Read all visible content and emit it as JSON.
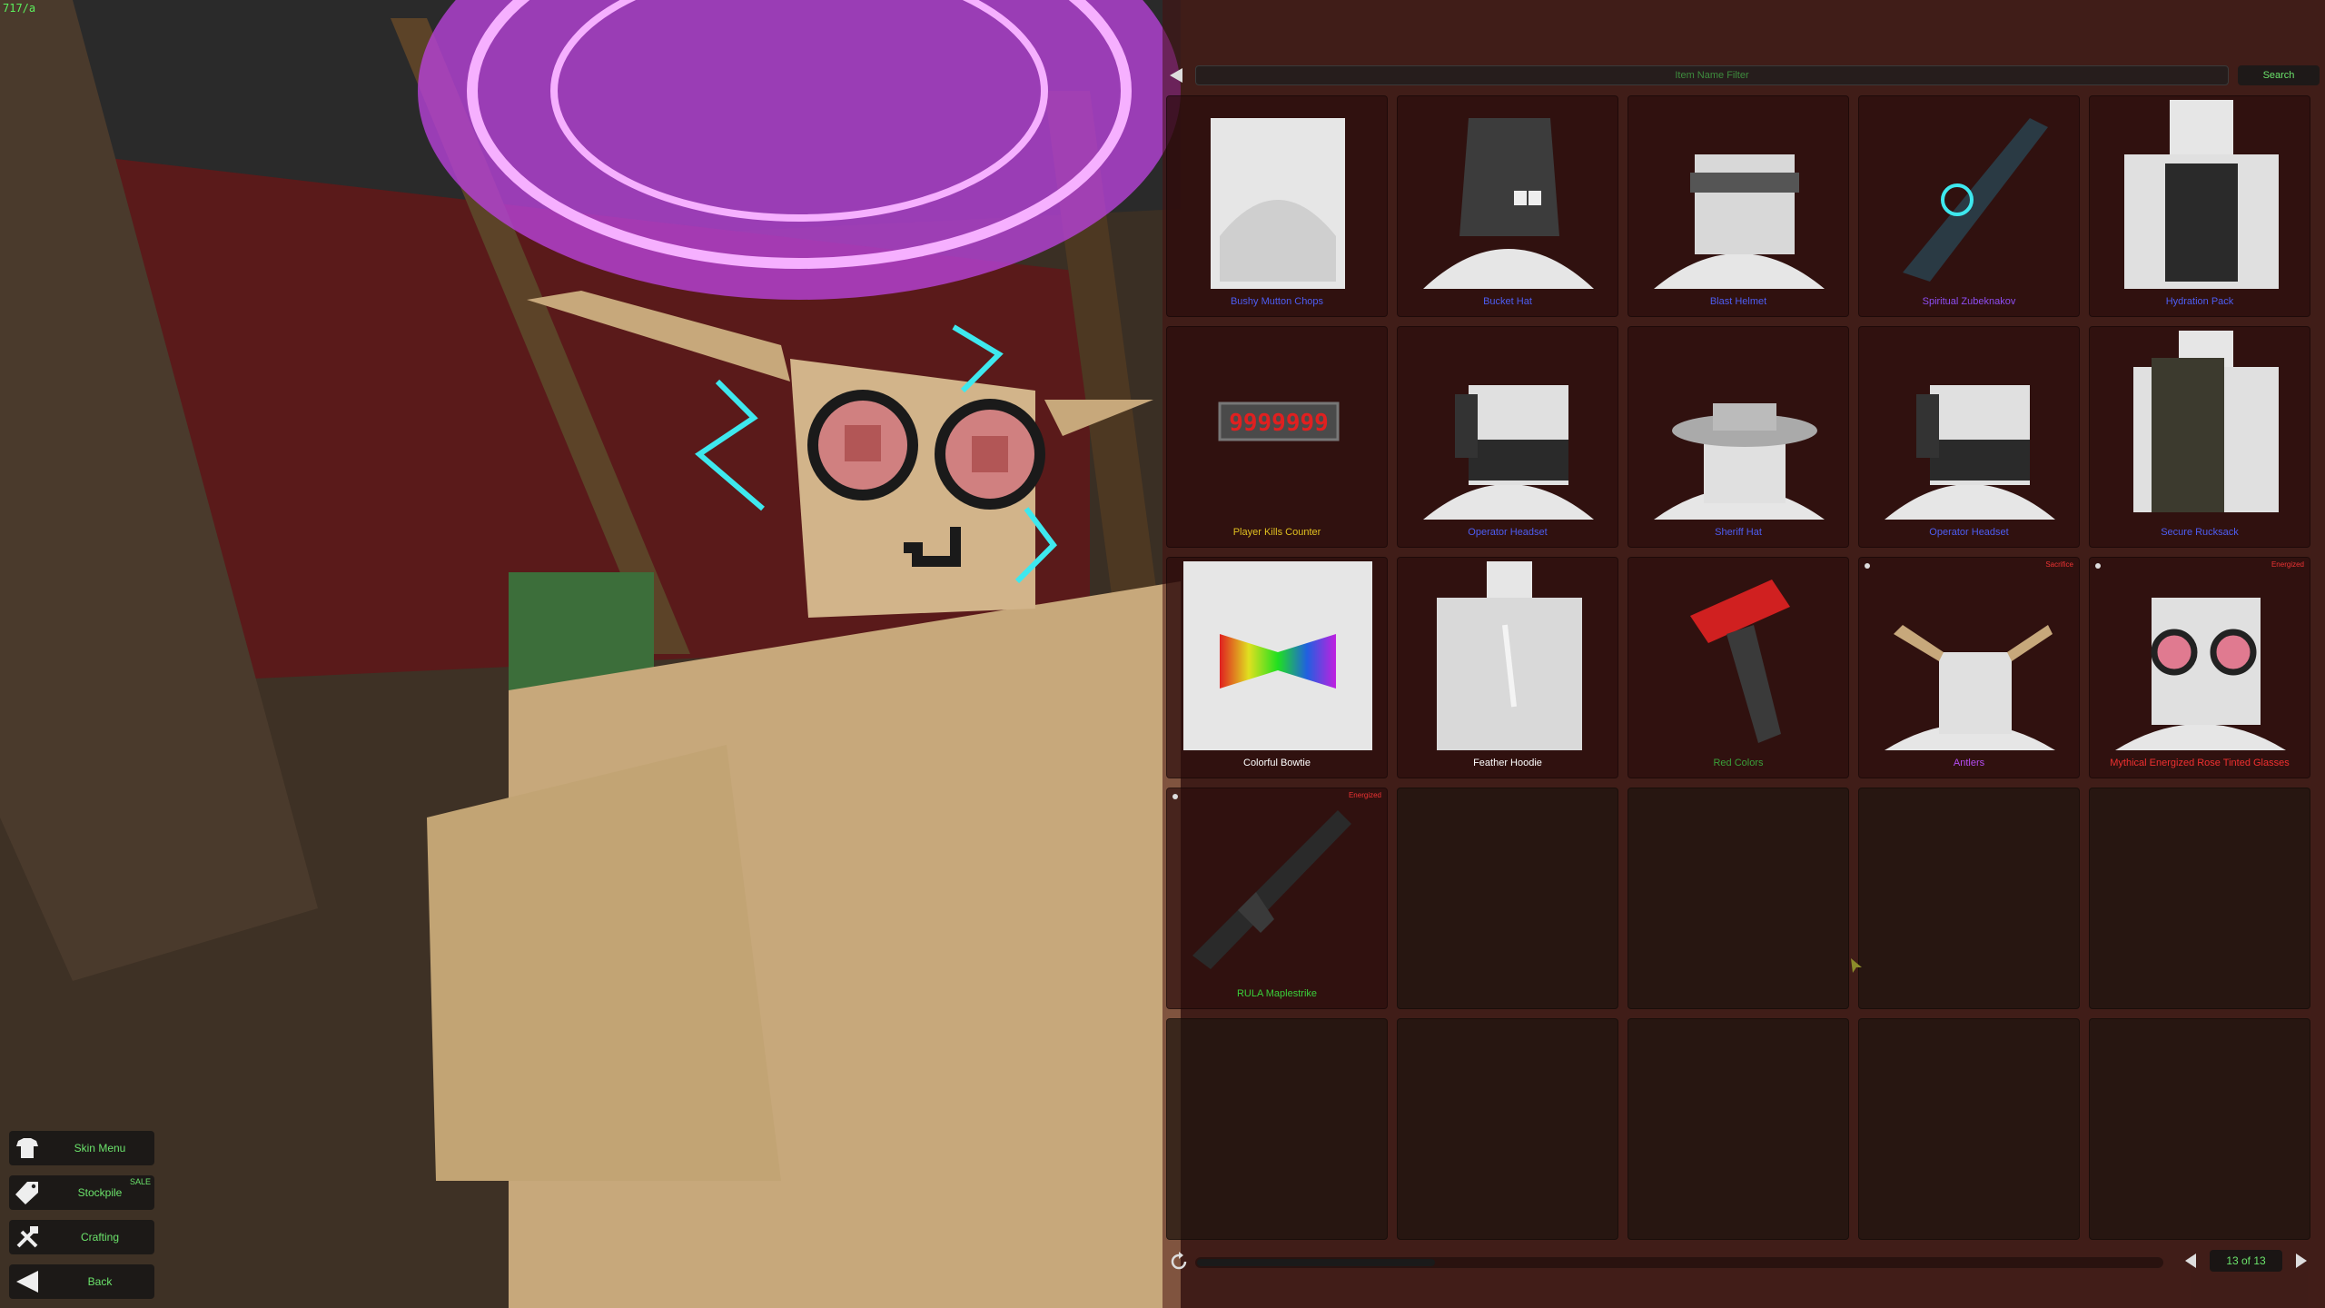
{
  "hud": {
    "fps": "717/a"
  },
  "filter": {
    "placeholder": "Item Name Filter",
    "search_label": "Search"
  },
  "items": [
    {
      "name": "Bushy Mutton Chops",
      "color": "#4d5df2"
    },
    {
      "name": "Bucket Hat",
      "color": "#4d5df2"
    },
    {
      "name": "Blast Helmet",
      "color": "#4d5df2"
    },
    {
      "name": "Spiritual Zubeknakov",
      "color": "#8d4df2"
    },
    {
      "name": "Hydration Pack",
      "color": "#4d5df2"
    },
    {
      "name": "Player Kills Counter",
      "color": "#e0c020",
      "counter": "9999999"
    },
    {
      "name": "Operator Headset",
      "color": "#4d5df2"
    },
    {
      "name": "Sheriff Hat",
      "color": "#4d5df2"
    },
    {
      "name": "Operator Headset",
      "color": "#4d5df2"
    },
    {
      "name": "Secure Rucksack",
      "color": "#4d5df2"
    },
    {
      "name": "Colorful Bowtie",
      "color": "#ffffff"
    },
    {
      "name": "Feather Hoodie",
      "color": "#ffffff"
    },
    {
      "name": "Red Colors",
      "color": "#3aa03a"
    },
    {
      "name": "Antlers",
      "color": "#b44df2",
      "rarity": "Sacrifice"
    },
    {
      "name": "Mythical Energized Rose Tinted Glasses",
      "color": "#f03030",
      "rarity": "Energized"
    },
    {
      "name": "RULA Maplestrike",
      "color": "#3ad03a",
      "rarity": "Energized"
    }
  ],
  "pagination": {
    "page_label": "13 of 13"
  },
  "menu": {
    "skin_label": "Skin Menu",
    "stockpile_label": "Stockpile",
    "stockpile_badge": "SALE",
    "crafting_label": "Crafting",
    "back_label": "Back"
  }
}
